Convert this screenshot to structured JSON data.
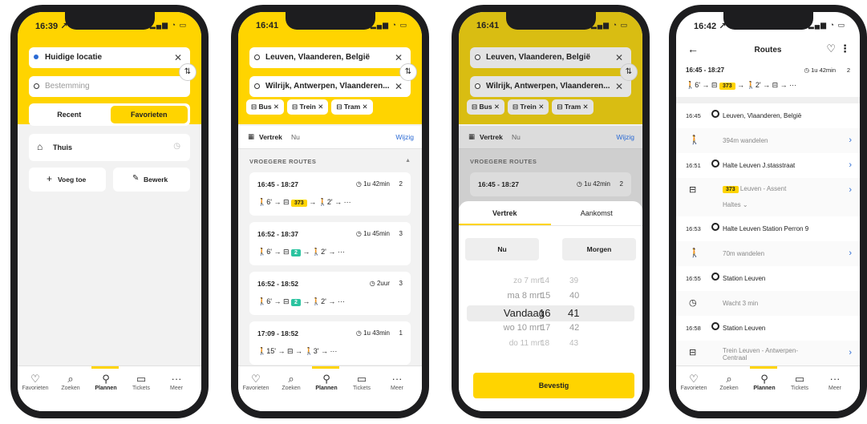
{
  "phone1": {
    "time": "16:39 ↗",
    "status_icons": "▂▄▆ ◔ ▭",
    "from": "Huidige locatie",
    "to_placeholder": "Bestemming",
    "tabs": {
      "recent": "Recent",
      "favorites": "Favorieten"
    },
    "home": "Thuis",
    "add": "Voeg toe",
    "edit": "Bewerk"
  },
  "phone2": {
    "time": "16:41",
    "status_icons": "▂▄▆ ◔ ▭",
    "from": "Leuven, Vlaanderen, België",
    "to": "Wilrijk, Antwerpen, Vlaanderen...",
    "chips": [
      "Bus",
      "Trein",
      "Tram"
    ],
    "departure_label": "Vertrek",
    "departure_value": "Nu",
    "change": "Wijzig",
    "earlier_routes": "VROEGERE ROUTES",
    "routes": [
      {
        "time": "16:45 - 18:27",
        "dur": "1u 42min",
        "changes": "2",
        "walk1": "6'",
        "line": "373",
        "walk2": "2'"
      },
      {
        "time": "16:52 - 18:37",
        "dur": "1u 45min",
        "changes": "3",
        "walk1": "6'",
        "line": "2",
        "walk2": "2'"
      },
      {
        "time": "16:52 - 18:52",
        "dur": "2uur",
        "changes": "3",
        "walk1": "6'",
        "line": "2",
        "walk2": "2'"
      },
      {
        "time": "17:09 - 18:52",
        "dur": "1u 43min",
        "changes": "1",
        "walk1": "15'",
        "line": "",
        "walk2": "3'"
      }
    ]
  },
  "phone3": {
    "time": "16:41",
    "status_icons": "▂▄▆ ◔ ▭",
    "from": "Leuven, Vlaanderen, België",
    "to": "Wilrijk, Antwerpen, Vlaanderen...",
    "chips": [
      "Bus",
      "Trein",
      "Tram"
    ],
    "departure_label": "Vertrek",
    "departure_value": "Nu",
    "change": "Wijzig",
    "earlier_routes": "VROEGERE ROUTES",
    "route_time": "16:45 - 18:27",
    "route_dur": "1u 42min",
    "route_changes": "2",
    "sheet_tabs": {
      "departure": "Vertrek",
      "arrival": "Aankomst"
    },
    "now": "Nu",
    "tomorrow": "Morgen",
    "picker": [
      {
        "day": "zo 7 mrt.",
        "h": "14",
        "m": "39"
      },
      {
        "day": "ma 8 mrt.",
        "h": "15",
        "m": "40"
      },
      {
        "day": "Vandaag",
        "h": "16",
        "m": "41"
      },
      {
        "day": "wo 10 mrt.",
        "h": "17",
        "m": "42"
      },
      {
        "day": "do 11 mrt.",
        "h": "18",
        "m": "43"
      }
    ],
    "confirm": "Bevestig"
  },
  "phone4": {
    "time": "16:42 ↗",
    "status_icons": "▂▄▆ ◔ ▭",
    "title": "Routes",
    "summary_time": "16:45 - 18:27",
    "summary_dur": "1u 42min",
    "summary_changes": "2",
    "timeline": [
      {
        "time": "16:45",
        "text": "Leuven, Vlaanderen, België",
        "type": "stop"
      },
      {
        "time": "",
        "text": "394m wandelen",
        "type": "walk"
      },
      {
        "time": "16:51",
        "text": "Halte Leuven J.stasstraat",
        "type": "stop"
      },
      {
        "time": "",
        "text": "Leuven - Assent",
        "type": "bus",
        "line": "373"
      },
      {
        "time": "16:53",
        "text": "Halte Leuven Station Perron 9",
        "type": "stop"
      },
      {
        "time": "",
        "text": "70m wandelen",
        "type": "walk"
      },
      {
        "time": "16:55",
        "text": "Station Leuven",
        "type": "stop"
      },
      {
        "time": "",
        "text": "Wacht 3 min",
        "type": "wait"
      },
      {
        "time": "16:58",
        "text": "Station Leuven",
        "type": "stop"
      },
      {
        "time": "",
        "text": "Trein Leuven - Antwerpen-Centraal",
        "type": "train"
      }
    ],
    "halts": "Haltes"
  },
  "tabbar": [
    "Favorieten",
    "Zoeken",
    "Plannen",
    "Tickets",
    "Meer"
  ],
  "colors": {
    "yellow": "#ffd400",
    "link": "#2a6ad4",
    "tram_green": "#2bc4a0"
  }
}
